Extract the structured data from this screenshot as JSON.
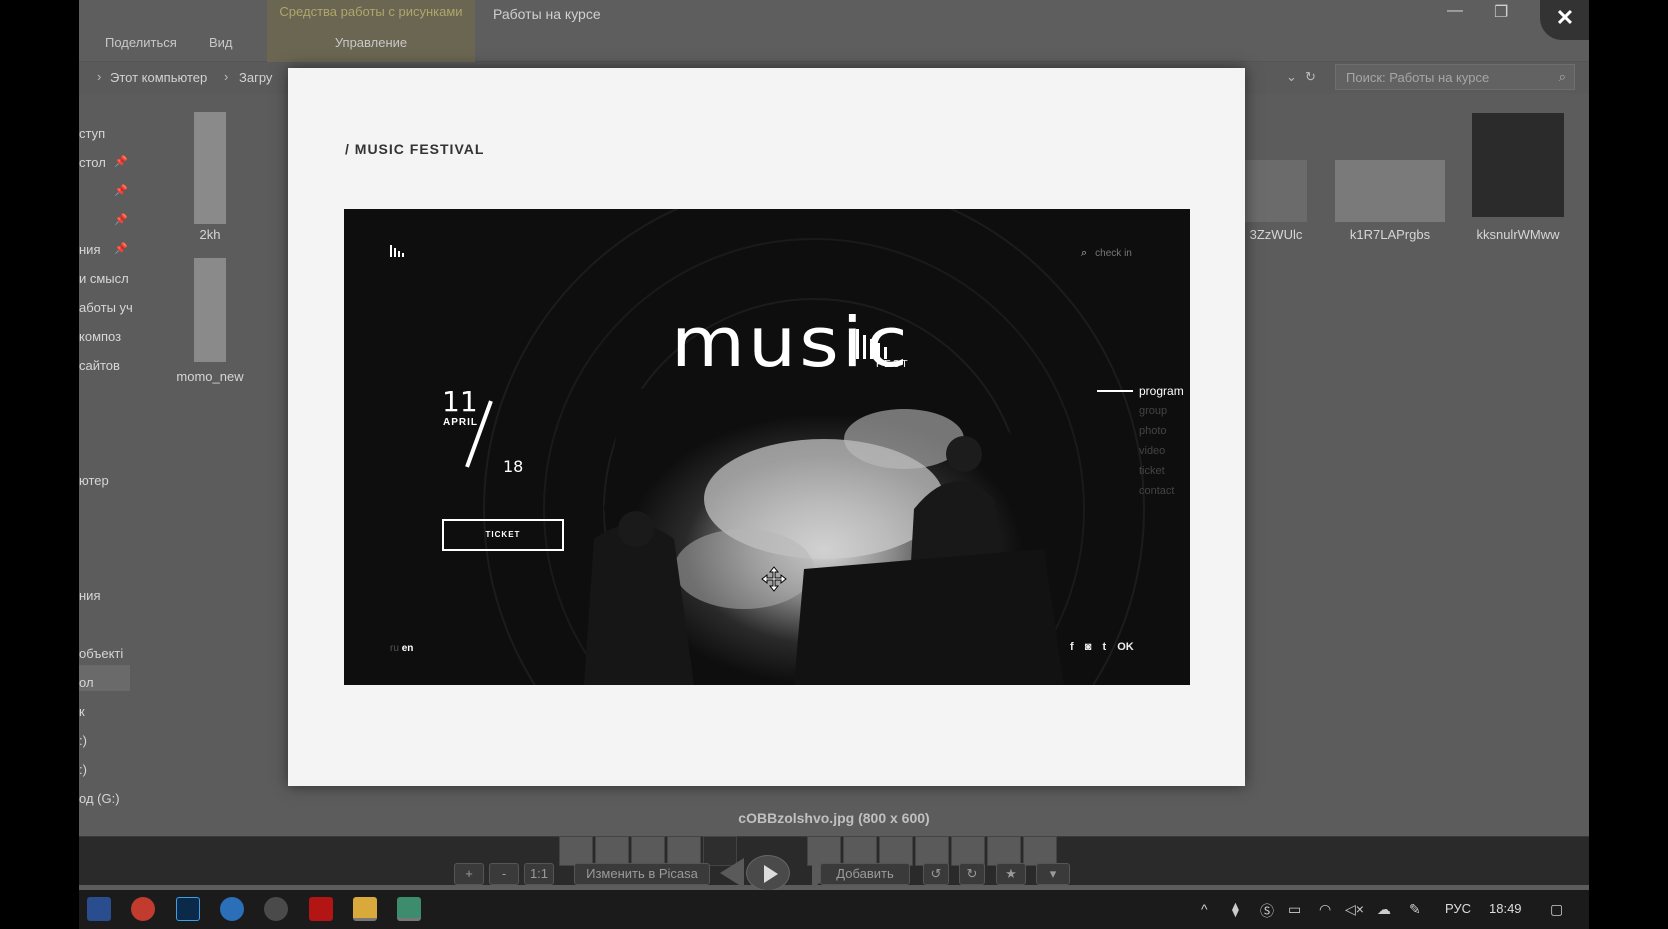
{
  "explorer": {
    "ribbon": {
      "context_group": "Средства работы с рисунками",
      "window_title": "Работы на курсе",
      "tabs": [
        "Поделиться",
        "Вид",
        "Управление"
      ]
    },
    "address": {
      "crumbs": [
        "Этот компьютер",
        "Загру"
      ]
    },
    "search_placeholder": "Поиск: Работы на курсе",
    "nav_items": [
      "ступ",
      "стол",
      "",
      "",
      "ния",
      "и смысл",
      "аботы уч",
      "композ",
      "сайтов",
      "ютер",
      "",
      "ния",
      "объекті",
      "ол",
      "к",
      ":)",
      ":)",
      "од (G:)"
    ],
    "files": [
      {
        "name": "2kh"
      },
      {
        "name": "momo_new"
      },
      {
        "name": "3ZzWUlc"
      },
      {
        "name": "k1R7LAPrgbs"
      },
      {
        "name": "kksnulrWMww"
      }
    ]
  },
  "viewer": {
    "image_heading": "/ MUSIC FESTIVAL",
    "caption": "cOBBzolshvo.jpg (800 x 600)",
    "mockup": {
      "search_text": "check in",
      "brand_word": "music",
      "brand_sub": "FEST",
      "date_day": "11",
      "date_month": "APRIL",
      "date_year": "18",
      "ticket_label": "TICKET",
      "menu": [
        "program",
        "group",
        "photo",
        "video",
        "ticket",
        "contact"
      ],
      "lang_inactive": "ru",
      "lang_active": "en",
      "social": [
        "f",
        "◙",
        "t",
        "OK"
      ]
    },
    "toolbar": {
      "zoom_in": "+",
      "zoom_out": "-",
      "actual_size": "1:1",
      "edit_in_picasa": "Изменить в Picasa",
      "add": "Добавить",
      "rotate_left": "↺",
      "rotate_right": "↻",
      "star": "★",
      "more": "▾"
    },
    "close_label": "✕"
  },
  "taskbar": {
    "lang": "РУС",
    "time": "18:49"
  }
}
